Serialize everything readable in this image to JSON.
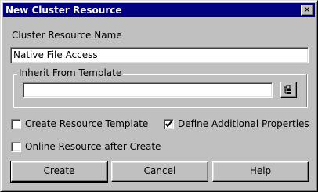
{
  "window": {
    "title": "New Cluster Resource",
    "close_glyph": "✕"
  },
  "fields": {
    "resource_name_label": "Cluster Resource Name",
    "resource_name_value": "Native File Access",
    "inherit_group_label": "Inherit From Template",
    "inherit_value": ""
  },
  "options": {
    "create_template_label": "Create Resource Template",
    "create_template_checked": false,
    "define_properties_label": "Define Additional Properties",
    "define_properties_checked": true,
    "online_after_create_label": "Online Resource after Create",
    "online_after_create_checked": false
  },
  "buttons": {
    "create": "Create",
    "cancel": "Cancel",
    "help": "Help"
  },
  "icons": {
    "close": "close-icon",
    "template_picker": "list-browse-icon",
    "checkmark": "checkmark-icon"
  },
  "colors": {
    "title_bar": "#000080",
    "face": "#c0c0c0"
  }
}
